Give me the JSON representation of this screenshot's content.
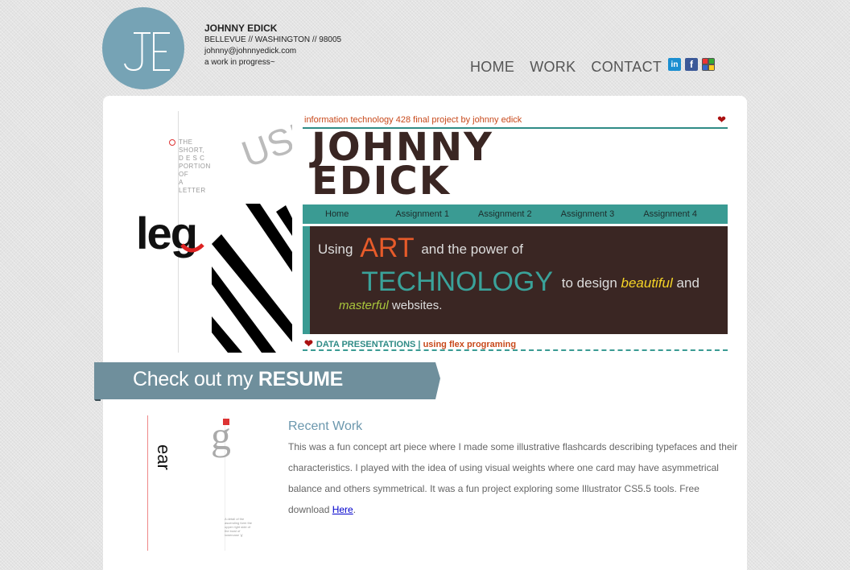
{
  "header": {
    "logo_text": "JE",
    "name": "JOHNNY EDICK",
    "location": "BELLEVUE // WASHINGTON // 98005",
    "email": "johnny@johnnyedick.com",
    "tagline": "a work in progress~"
  },
  "nav": {
    "items": [
      "HOME",
      "WORK",
      "CONTACT"
    ]
  },
  "social": {
    "linkedin_label": "in",
    "facebook_label": "f",
    "googleplus_label": "+"
  },
  "featured": {
    "left_art": {
      "short_text": [
        "THE",
        "SHORT,",
        "D E S C",
        "PORTION",
        "OF",
        "A",
        "LETTER"
      ],
      "word": "leg",
      "rotated_word": "USE"
    },
    "screenshot": {
      "tagline": "information technology 428 final project by johnny edick",
      "name_line1": "JOHNNY",
      "name_line2": "EDICK",
      "nav_items": [
        "Home",
        "Assignment 1",
        "Assignment 2",
        "Assignment 3",
        "Assignment 4"
      ],
      "banner": {
        "using": "Using",
        "art": "ART",
        "power": "and the power of",
        "technology": "TECHNOLOGY",
        "to_design": "to design",
        "beautiful": "beautiful",
        "and": "and",
        "masterful": "masterful",
        "websites": "websites."
      },
      "bottom_left": "DATA PRESENTATIONS",
      "bottom_sep": " | ",
      "bottom_right": "using flex programing"
    }
  },
  "resume": {
    "prefix": "Check out my ",
    "bold": "RESUME"
  },
  "recent": {
    "art_word": "ear",
    "art_letter": "g",
    "art_small_text": "A detail of the ascending form the upper right side of the bowl of lowercase 'g'",
    "title": "Recent Work",
    "body": "This was a fun concept art piece where I made some illustrative flashcards describing typefaces and their characteristics. I played with the idea of using visual weights where one card may have asymmetrical balance and others symmetrical. It was a fun project exploring some Illustrator CS5.5 tools. Free download ",
    "link_text": "Here",
    "trailing": "."
  },
  "colors": {
    "logo_circle": "#76a3b5",
    "teal": "#3a9b93",
    "dark_brown": "#3a2623",
    "orange": "#e85b2a",
    "ribbon": "#6f8f9c",
    "recent_title": "#6b97ad"
  }
}
